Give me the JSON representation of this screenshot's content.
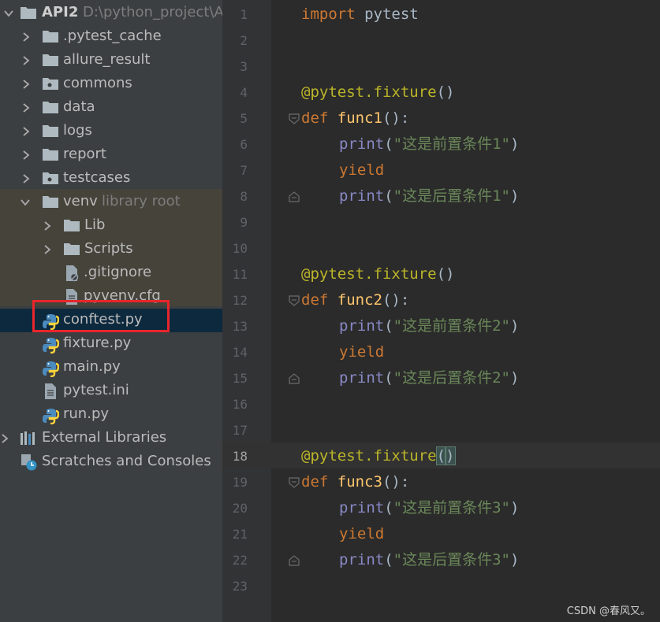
{
  "project": {
    "name": "API2",
    "path": "D:\\python_project\\A",
    "items": [
      {
        "label": "venv",
        "suffix": "library root"
      }
    ]
  },
  "tree": {
    "pytest_cache": ".pytest_cache",
    "allure_result": "allure_result",
    "commons": "commons",
    "data": "data",
    "logs": "logs",
    "report": "report",
    "testcases": "testcases",
    "venv": "venv",
    "venv_suffix": "library root",
    "lib": "Lib",
    "scripts": "Scripts",
    "gitignore": ".gitignore",
    "pyvenv": "pyvenv.cfg",
    "conftest": "conftest.py",
    "fixture": "fixture.py",
    "main": "main.py",
    "pytest_ini": "pytest.ini",
    "run": "run.py",
    "external": "External Libraries",
    "scratches": "Scratches and Consoles"
  },
  "editor": {
    "line_numbers": [
      "1",
      "2",
      "3",
      "4",
      "5",
      "6",
      "7",
      "8",
      "9",
      "10",
      "11",
      "12",
      "13",
      "14",
      "15",
      "16",
      "17",
      "18",
      "19",
      "20",
      "21",
      "22",
      "23"
    ],
    "current_line": 18,
    "lines": {
      "l1_kw": "import",
      "l1_rest": " pytest",
      "deco1": "@pytest.fixture",
      "deco_paren": "()",
      "def": "def",
      "func1": "func1",
      "func2": "func2",
      "func3": "func3",
      "sig_end": "():",
      "print": "print",
      "yield": "yield",
      "s_pre1": "\"这是前置条件1\"",
      "s_post1": "\"这是后置条件1\"",
      "s_pre2": "\"这是前置条件2\"",
      "s_post2": "\"这是后置条件2\"",
      "s_pre3": "\"这是前置条件3\"",
      "s_post3": "\"这是后置条件3\"",
      "open": "(",
      "close": ")"
    }
  },
  "watermark": "CSDN @春风又。",
  "colors": {
    "sidebar_bg": "#3c3f41",
    "editor_bg": "#2b2b2b",
    "keyword": "#cc7832",
    "decorator": "#bbb529",
    "function": "#ffc66d",
    "builtin": "#8888c6",
    "string": "#6a8759",
    "highlight_box": "#e8262b"
  }
}
